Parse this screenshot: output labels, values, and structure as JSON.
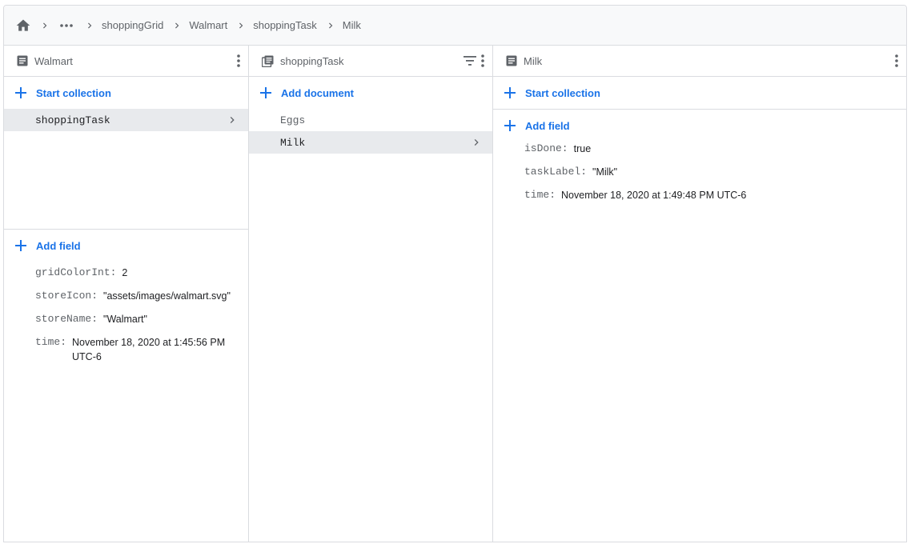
{
  "breadcrumb": {
    "home_icon": "home-icon",
    "ellipsis_icon": "more-horizontal-icon",
    "items": [
      "shoppingGrid",
      "Walmart",
      "shoppingTask",
      "Milk"
    ]
  },
  "panel_document_walmart": {
    "title": "Walmart",
    "header_icon": "document-icon",
    "start_collection": "Start collection",
    "collections": [
      {
        "label": "shoppingTask",
        "selected": true
      }
    ],
    "add_field": "Add field",
    "fields": [
      {
        "key": "gridColorInt:",
        "value": "2"
      },
      {
        "key": "storeIcon:",
        "value": "\"assets/images/walmart.svg\""
      },
      {
        "key": "storeName:",
        "value": "\"Walmart\""
      },
      {
        "key": "time:",
        "value": "November 18, 2020 at 1:45:56 PM UTC-6"
      }
    ]
  },
  "panel_collection": {
    "title": "shoppingTask",
    "header_icon": "collection-icon",
    "add_document": "Add document",
    "documents": [
      {
        "label": "Eggs",
        "selected": false
      },
      {
        "label": "Milk",
        "selected": true
      }
    ]
  },
  "panel_document_milk": {
    "title": "Milk",
    "header_icon": "document-icon",
    "start_collection": "Start collection",
    "add_field": "Add field",
    "fields": [
      {
        "key": "isDone:",
        "value": "true"
      },
      {
        "key": "taskLabel:",
        "value": "\"Milk\""
      },
      {
        "key": "time:",
        "value": "November 18, 2020 at 1:49:48 PM UTC-6"
      }
    ]
  },
  "colors": {
    "accent": "#1a73e8",
    "selected_bg": "#e8eaed",
    "border": "#dadce0",
    "muted_text": "#5f6368"
  }
}
